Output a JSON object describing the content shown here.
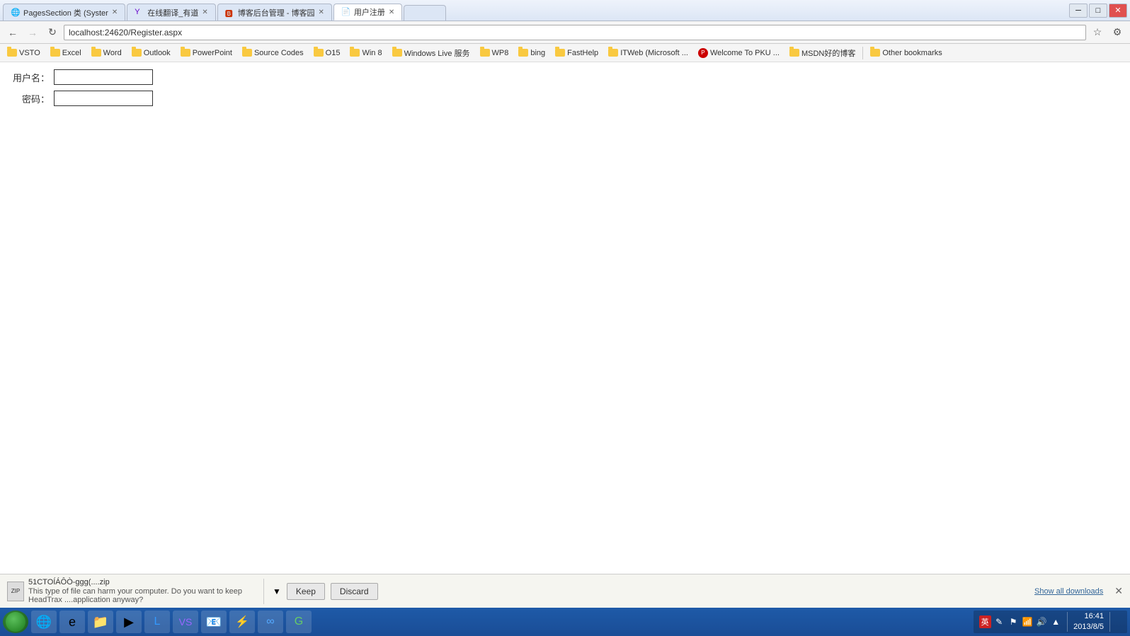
{
  "window": {
    "title": "用户注册",
    "controls": {
      "minimize": "─",
      "maximize": "□",
      "close": "✕"
    }
  },
  "tabs": [
    {
      "id": "tab1",
      "label": "PagesSection 类 (Syster",
      "active": false,
      "icon": "ie-icon"
    },
    {
      "id": "tab2",
      "label": "在线翻译_有道",
      "active": false,
      "icon": "y-icon"
    },
    {
      "id": "tab3",
      "label": "博客后台管理 - 博客园",
      "active": false,
      "icon": "blog-icon"
    },
    {
      "id": "tab4",
      "label": "用户注册",
      "active": true,
      "icon": "page-icon"
    }
  ],
  "navigation": {
    "address": "localhost:24620/Register.aspx",
    "back_disabled": false,
    "forward_disabled": true
  },
  "bookmarks": [
    {
      "label": "VSTO",
      "type": "folder"
    },
    {
      "label": "Excel",
      "type": "folder"
    },
    {
      "label": "Word",
      "type": "folder"
    },
    {
      "label": "Outlook",
      "type": "folder"
    },
    {
      "label": "PowerPoint",
      "type": "folder"
    },
    {
      "label": "Source Codes",
      "type": "folder"
    },
    {
      "label": "O15",
      "type": "folder"
    },
    {
      "label": "Win 8",
      "type": "folder"
    },
    {
      "label": "Windows Live 服务",
      "type": "folder"
    },
    {
      "label": "WP8",
      "type": "folder"
    },
    {
      "label": "bing",
      "type": "folder"
    },
    {
      "label": "FastHelp",
      "type": "folder"
    },
    {
      "label": "ITWeb (Microsoft ...",
      "type": "folder"
    },
    {
      "label": "Welcome To PKU ...",
      "type": "folder"
    },
    {
      "label": "MSDN好的博客",
      "type": "folder"
    },
    {
      "label": "Other bookmarks",
      "type": "folder"
    }
  ],
  "form": {
    "username_label": "用户名：",
    "password_label": "密码：",
    "username_value": "",
    "password_value": ""
  },
  "download_bar": {
    "filename": "51CTOÍÁÔÒ-ggg(....zip",
    "warning_text": "This type of file can harm your computer. Do you want to keep HeadTrax ....application anyway?",
    "keep_label": "Keep",
    "discard_label": "Discard",
    "show_all_label": "Show all downloads"
  },
  "taskbar": {
    "time": "16:41",
    "date": "2013/8/5",
    "ime_label": "英"
  }
}
